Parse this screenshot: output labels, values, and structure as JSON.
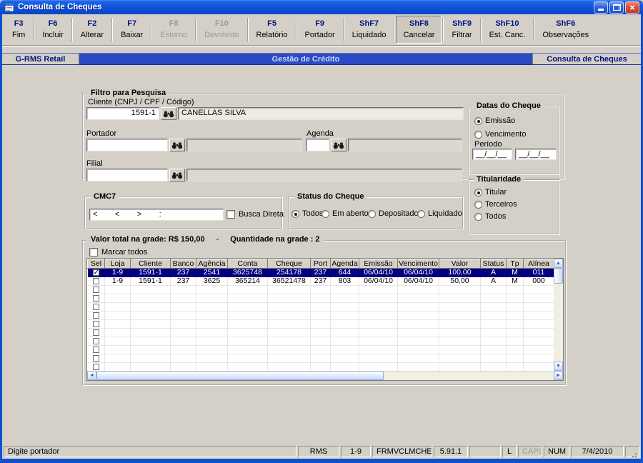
{
  "window": {
    "title": "Consulta de Cheques"
  },
  "toolbar": {
    "items": [
      {
        "key": "F3",
        "label": "Fim"
      },
      {
        "key": "F6",
        "label": "Incluir"
      },
      {
        "key": "F2",
        "label": "Alterar"
      },
      {
        "key": "F7",
        "label": "Baixar"
      },
      {
        "key": "F8",
        "label": "Estorno"
      },
      {
        "key": "F10",
        "label": "Devolvido"
      },
      {
        "key": "F5",
        "label": "Relatório"
      },
      {
        "key": "F9",
        "label": "Portador"
      },
      {
        "key": "ShF7",
        "label": "Liquidado"
      },
      {
        "key": "ShF8",
        "label": "Cancelar"
      },
      {
        "key": "ShF9",
        "label": "Filtrar"
      },
      {
        "key": "ShF10",
        "label": "Est. Canc."
      },
      {
        "key": "ShF6",
        "label": "Observações"
      }
    ]
  },
  "navbar": {
    "left": "G-RMS Retail",
    "center": "Gestão de Crédito",
    "right": "Consulta de Cheques"
  },
  "filtro": {
    "title": "Filtro para Pesquisa",
    "cliente_label": "Cliente (CNPJ / CPF / Código)",
    "cliente_code": "1591-1",
    "cliente_name": "CANELLAS SILVA",
    "portador_label": "Portador",
    "portador_code": "",
    "portador_name": "",
    "agenda_label": "Agenda",
    "agenda_code": "",
    "agenda_name": "",
    "filial_label": "Filial",
    "filial_code": "",
    "filial_name": ""
  },
  "datas_cheque": {
    "title": "Datas do Cheque",
    "option_emissao": "Emissão",
    "option_vencimento": "Vencimento",
    "selected": "Emissão",
    "periodo_label": "Período",
    "periodo_de": "__/__/__",
    "periodo_ate": "__/__/__"
  },
  "cmc7": {
    "title": "CMC7",
    "value": "<        <        >        :",
    "busca_direta_label": "Busca Direta",
    "busca_direta_checked": false
  },
  "status_cheque": {
    "title": "Status do Cheque",
    "options": [
      "Todos",
      "Em aberto",
      "Depositado",
      "Liquidado"
    ],
    "selected": "Todos"
  },
  "titularidade": {
    "title": "Titularidade",
    "options": [
      "Titular",
      "Terceiros",
      "Todos"
    ],
    "selected": "Titular"
  },
  "grade": {
    "valor_total": "Valor total na grade: R$ 150,00",
    "separator": "-",
    "quantidade": "Quantidade na grade : 2",
    "marcar_todos_label": "Marcar todos",
    "columns": [
      "Sel",
      "Loja",
      "Cliente",
      "Banco",
      "Agência",
      "Conta",
      "Cheque",
      "Port",
      "Agenda",
      "Emissão",
      "Vencimento",
      "Valor",
      "Status",
      "Tp",
      "Alínea"
    ],
    "rows": [
      {
        "checked": true,
        "selected": true,
        "cells": [
          "1-9",
          "1591-1",
          "237",
          "2541",
          "3625748",
          "254178",
          "237",
          "644",
          "06/04/10",
          "06/04/10",
          "100,00",
          "A",
          "M",
          "011"
        ]
      },
      {
        "checked": false,
        "selected": false,
        "cells": [
          "1-9",
          "1591-1",
          "237",
          "3625",
          "365214",
          "36521478",
          "237",
          "803",
          "06/04/10",
          "06/04/10",
          "50,00",
          "A",
          "M",
          "000"
        ]
      }
    ],
    "empty_row_count": 10
  },
  "statusbar": {
    "message": "Digite portador",
    "panels": [
      "RMS",
      "1-9",
      "FRMVCLMCHEQ",
      "5.91.1",
      "",
      "L",
      "CAPS",
      "NUM",
      "7/4/2010"
    ]
  }
}
